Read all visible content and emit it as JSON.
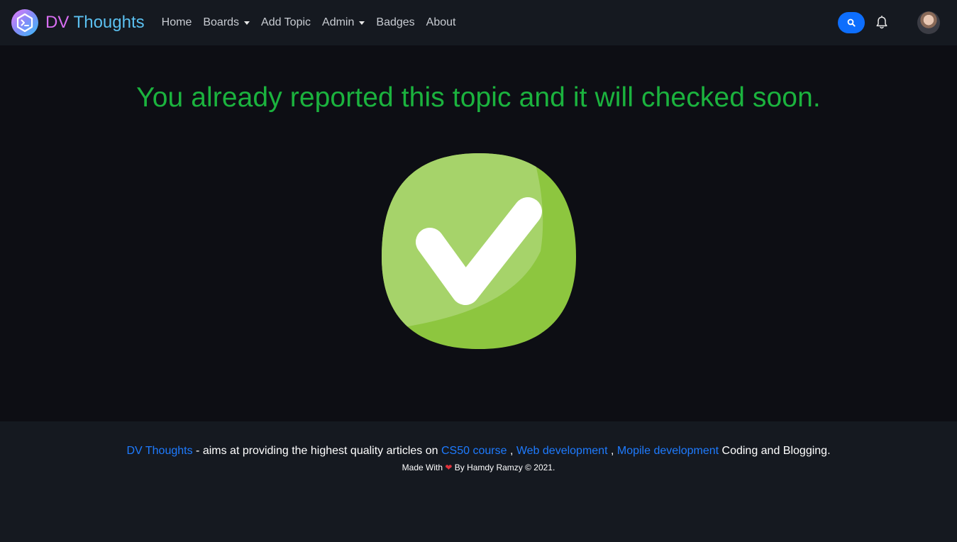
{
  "brand": {
    "dv": "DV",
    "thoughts": "Thoughts"
  },
  "nav": {
    "home": "Home",
    "boards": "Boards",
    "add_topic": "Add Topic",
    "admin": "Admin",
    "badges": "Badges",
    "about": "About"
  },
  "icons": {
    "brand_logo": "terminal-hexagon-icon",
    "search": "search-icon",
    "bell": "bell-icon",
    "avatar": "user-avatar",
    "check": "check-mark-icon",
    "heart": "heart-icon"
  },
  "main": {
    "message": "You already reported this topic and it will checked soon."
  },
  "footer": {
    "dv": "DV",
    "thoughts": "Thoughts",
    "description": " - aims at providing the highest quality articles on ",
    "link_cs50": "CS50 course",
    "sep1": " , ",
    "link_web": "Web development",
    "sep2": " , ",
    "link_mobile": "Mopile development",
    "tail": " Coding and Blogging.",
    "made_with": "Made With ",
    "heart": "❤",
    "by": " By Hamdy Ramzy © 2021."
  },
  "colors": {
    "accent_blue": "#0d6efd",
    "success_green": "#1bb33e",
    "check_green": "#8dc63f",
    "brand_pink": "#d86ef2",
    "brand_cyan": "#5bc0f0"
  }
}
